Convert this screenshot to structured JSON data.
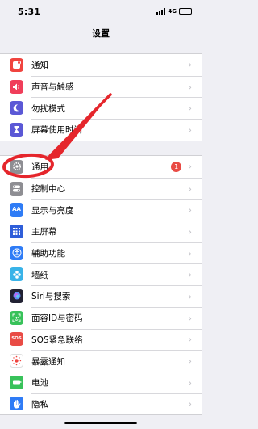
{
  "status": {
    "time": "5:31",
    "network": "4G"
  },
  "header": {
    "title": "设置"
  },
  "groups": [
    {
      "items": [
        {
          "label": "通知",
          "icon": "notification-icon",
          "color": "#f0443f"
        },
        {
          "label": "声音与触感",
          "icon": "speaker-icon",
          "color": "#f03e5a"
        },
        {
          "label": "勿扰模式",
          "icon": "moon-icon",
          "color": "#5b58d6"
        },
        {
          "label": "屏幕使用时间",
          "icon": "hourglass-icon",
          "color": "#5b58d6"
        }
      ]
    },
    {
      "items": [
        {
          "label": "通用",
          "icon": "gear-icon",
          "color": "#8e8e93",
          "badge": "1"
        },
        {
          "label": "控制中心",
          "icon": "toggle-icon",
          "color": "#8e8e93"
        },
        {
          "label": "显示与亮度",
          "icon": "aa-icon",
          "color": "#2f7cf6",
          "glyph": "AA"
        },
        {
          "label": "主屏幕",
          "icon": "grid-icon",
          "color": "#2f5ed9"
        },
        {
          "label": "辅助功能",
          "icon": "accessibility-icon",
          "color": "#2f7cf6"
        },
        {
          "label": "墙纸",
          "icon": "flower-icon",
          "color": "#39b3e8"
        },
        {
          "label": "Siri与搜索",
          "icon": "siri-icon",
          "color": "#222233"
        },
        {
          "label": "面容ID与密码",
          "icon": "faceid-icon",
          "color": "#38c25a"
        },
        {
          "label": "SOS紧急联络",
          "icon": "sos-icon",
          "color": "#e94b45",
          "glyph": "SOS"
        },
        {
          "label": "暴露通知",
          "icon": "exposure-icon",
          "color": "#ffffff"
        },
        {
          "label": "电池",
          "icon": "battery-icon",
          "color": "#38c25a"
        },
        {
          "label": "隐私",
          "icon": "hand-icon",
          "color": "#2f7cf6"
        }
      ]
    }
  ],
  "annotation": {
    "highlight_color": "#e5262c"
  }
}
